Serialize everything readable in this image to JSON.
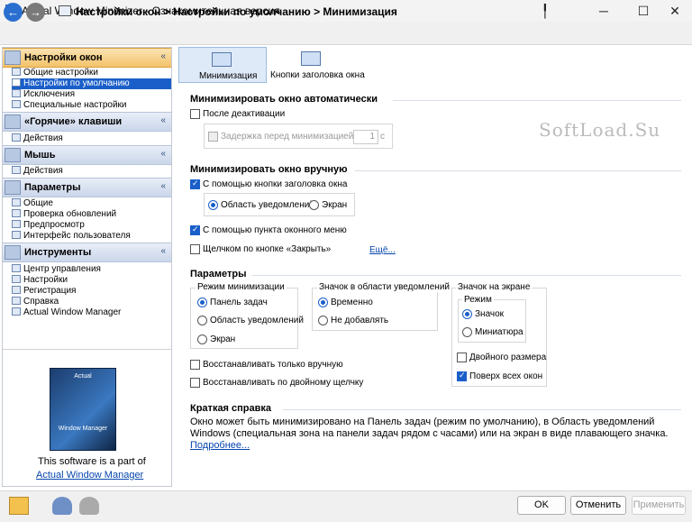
{
  "window": {
    "title": "Actual Window Minimizer - Ознакомительная версия",
    "controls": {
      "pin": "╿",
      "minimize": "─",
      "maximize": "☐",
      "close": "✕"
    }
  },
  "nav": {
    "breadcrumb": "Настройки окон > Настройки по умолчанию > Минимизация",
    "back": "←",
    "forward": "→"
  },
  "sidebar": {
    "sections": [
      {
        "title": "Настройки окон",
        "items": [
          "Общие настройки",
          "Настройки по умолчанию",
          "Исключения",
          "Специальные настройки"
        ]
      },
      {
        "title": "«Горячие» клавиши",
        "items": [
          "Действия"
        ]
      },
      {
        "title": "Мышь",
        "items": [
          "Действия"
        ]
      },
      {
        "title": "Параметры",
        "items": [
          "Общие",
          "Проверка обновлений",
          "Предпросмотр",
          "Интерфейс пользователя"
        ]
      },
      {
        "title": "Инструменты",
        "items": [
          "Центр управления",
          "Настройки",
          "Регистрация",
          "Справка",
          "Actual Window Manager"
        ]
      }
    ],
    "chevron": "«",
    "box_art_label": "Window Manager",
    "box_art_brand": "Actual",
    "promo_text": "This software is a part of",
    "promo_link": "Actual Window Manager"
  },
  "tabs": {
    "minimization": "Минимизация",
    "title_buttons": "Кнопки заголовка окна"
  },
  "auto": {
    "title": "Минимизировать окно автоматически",
    "after_deactivation": "После деактивации",
    "delay": "Задержка перед минимизацией",
    "delay_value": "1",
    "delay_unit": "с"
  },
  "manual": {
    "title": "Минимизировать окно вручную",
    "title_button": "С помощью кнопки заголовка окна",
    "tray": "Область уведомлений",
    "screen": "Экран",
    "window_menu": "С помощью пункта оконного меню",
    "close_click": "Щелчком по кнопке «Закрыть»",
    "more": "Ещё..."
  },
  "params": {
    "title": "Параметры",
    "mode_caption": "Режим минимизации",
    "mode_taskbar": "Панель задач",
    "mode_tray": "Область уведомлений",
    "mode_screen": "Экран",
    "tray_caption": "Значок в области уведомлений",
    "tray_temp": "Временно",
    "tray_none": "Не добавлять",
    "screen_caption": "Значок на экране",
    "screen_mode": "Режим",
    "screen_icon": "Значок",
    "screen_thumb": "Миниатюра",
    "double_size": "Двойного размера",
    "on_top": "Поверх всех окон",
    "restore_manual": "Восстанавливать только вручную",
    "restore_dblclick": "Восстанавливать по двойному щелчку"
  },
  "help": {
    "title": "Краткая справка",
    "text": "Окно может быть минимизировано на Панель задач (режим по умолчанию), в Область уведомлений Windows (специальная зона на панели задач рядом с часами) или на экран в виде плавающего значка.",
    "more": "Подробнее..."
  },
  "watermark": "SoftLoad.Su",
  "buttons": {
    "ok": "OK",
    "cancel": "Отменить",
    "apply": "Применить"
  },
  "colors": {
    "accent": "#1a5fc9",
    "active_section": "#f3c36a"
  }
}
